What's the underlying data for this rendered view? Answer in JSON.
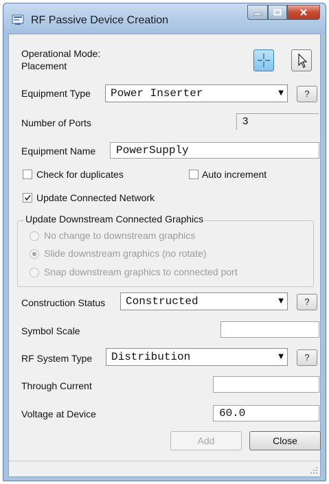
{
  "window": {
    "title": "RF Passive Device Creation",
    "min_icon": "minimize-icon",
    "max_icon": "maximize-icon",
    "close_icon": "close-icon"
  },
  "operational_mode": {
    "label": "Operational Mode:",
    "value": "Placement"
  },
  "tools": {
    "crosshair_icon": "crosshair-icon",
    "pointer_icon": "pointer-icon"
  },
  "equipment_type": {
    "label": "Equipment Type",
    "value": "Power Inserter",
    "help": "?"
  },
  "number_of_ports": {
    "label": "Number of Ports",
    "value": "3"
  },
  "equipment_name": {
    "label": "Equipment Name",
    "value": "PowerSupply"
  },
  "checks": {
    "duplicates": {
      "label": "Check for duplicates",
      "checked": false
    },
    "auto_increment": {
      "label": "Auto increment",
      "checked": false
    },
    "update_network": {
      "label": "Update Connected Network",
      "checked": true
    }
  },
  "downstream": {
    "legend": "Update Downstream Connected Graphics",
    "options": [
      "No change to downstream graphics",
      "Slide downstream graphics (no rotate)",
      "Snap downstream graphics to connected port"
    ],
    "selected_index": 1
  },
  "construction_status": {
    "label": "Construction Status",
    "value": "Constructed",
    "help": "?"
  },
  "symbol_scale": {
    "label": "Symbol Scale",
    "value": ""
  },
  "rf_system_type": {
    "label": "RF System Type",
    "value": "Distribution",
    "help": "?"
  },
  "through_current": {
    "label": "Through Current",
    "value": ""
  },
  "voltage": {
    "label": "Voltage at Device",
    "value": "60.0"
  },
  "buttons": {
    "add": "Add",
    "close": "Close"
  },
  "colors": {
    "title_bar": "#a9c2dd",
    "close_button": "#c74a33",
    "active_tool": "#9ed2f4"
  }
}
